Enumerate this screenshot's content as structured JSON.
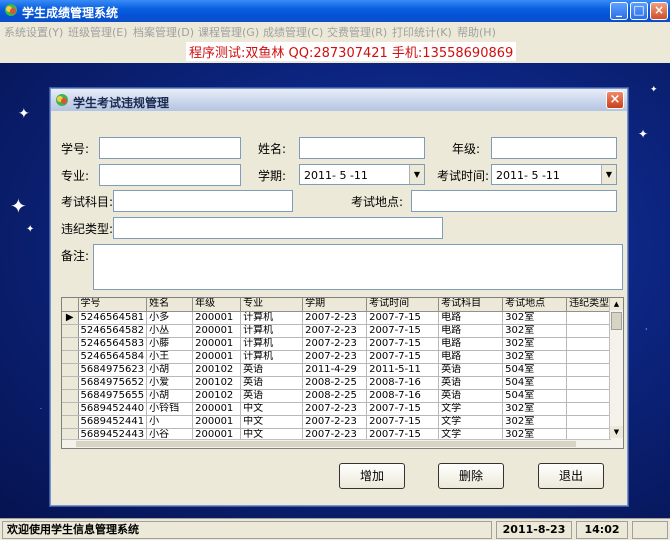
{
  "app": {
    "title": "学生成绩管理系统",
    "minimize": "_",
    "maximize": "□",
    "close": "×"
  },
  "menu": [
    "系统设置(Y)",
    "班级管理(E)",
    "档案管理(D)",
    "课程管理(G)",
    "成绩管理(C)",
    "交费管理(R)",
    "打印统计(K)",
    "帮助(H)"
  ],
  "banner": "程序测试:双鱼林 QQ:287307421 手机:13558690869",
  "dialog": {
    "title": "学生考试违规管理",
    "close": "×",
    "labels": {
      "student_id": "学号:",
      "name": "姓名:",
      "grade": "年级:",
      "major": "专业:",
      "term": "学期:",
      "exam_time": "考试时间:",
      "subject": "考试科目:",
      "location": "考试地点:",
      "violation_type": "违纪类型:",
      "remark": "备注:"
    },
    "values": {
      "student_id": "",
      "name": "",
      "grade": "",
      "major": "",
      "term": "2011- 5 -11",
      "exam_time": "2011- 5 -11",
      "subject": "",
      "location": "",
      "violation_type": "",
      "remark": ""
    },
    "grid": {
      "columns": [
        "学号",
        "姓名",
        "年级",
        "专业",
        "学期",
        "考试时间",
        "考试科目",
        "考试地点",
        "违纪类型"
      ],
      "rows": [
        [
          "5246564581",
          "小多",
          "200001",
          "计算机",
          "2007-2-23",
          "2007-7-15",
          "电路",
          "302室",
          ""
        ],
        [
          "5246564582",
          "小丛",
          "200001",
          "计算机",
          "2007-2-23",
          "2007-7-15",
          "电路",
          "302室",
          ""
        ],
        [
          "5246564583",
          "小藤",
          "200001",
          "计算机",
          "2007-2-23",
          "2007-7-15",
          "电路",
          "302室",
          ""
        ],
        [
          "5246564584",
          "小王",
          "200001",
          "计算机",
          "2007-2-23",
          "2007-7-15",
          "电路",
          "302室",
          ""
        ],
        [
          "5684975623",
          "小胡",
          "200102",
          "英语",
          "2011-4-29",
          "2011-5-11",
          "英语",
          "504室",
          ""
        ],
        [
          "5684975652",
          "小爱",
          "200102",
          "英语",
          "2008-2-25",
          "2008-7-16",
          "英语",
          "504室",
          ""
        ],
        [
          "5684975655",
          "小胡",
          "200102",
          "英语",
          "2008-2-25",
          "2008-7-16",
          "英语",
          "504室",
          ""
        ],
        [
          "5689452440",
          "小铃铛",
          "200001",
          "中文",
          "2007-2-23",
          "2007-7-15",
          "文学",
          "302室",
          ""
        ],
        [
          "5689452441",
          "小",
          "200001",
          "中文",
          "2007-2-23",
          "2007-7-15",
          "文学",
          "302室",
          ""
        ],
        [
          "5689452443",
          "小谷",
          "200001",
          "中文",
          "2007-2-23",
          "2007-7-15",
          "文学",
          "302室",
          ""
        ]
      ]
    },
    "buttons": {
      "add": "增加",
      "delete": "删除",
      "exit": "退出"
    }
  },
  "status": {
    "welcome": "欢迎使用学生信息管理系统",
    "date": "2011-8-23",
    "time": "14:02"
  }
}
